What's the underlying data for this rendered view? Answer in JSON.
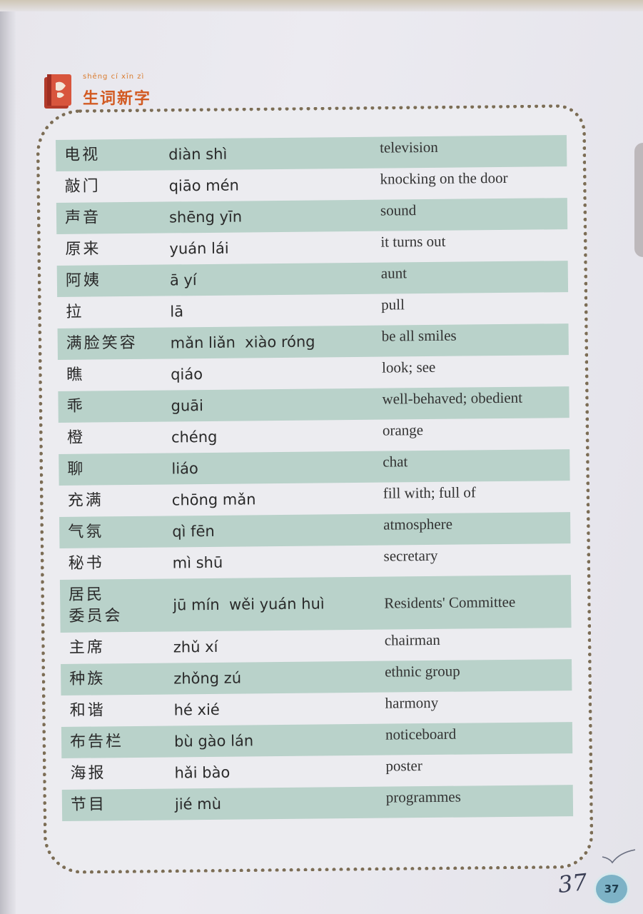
{
  "header": {
    "pinyin": "shēng cí  xīn zì",
    "title": "生词新字"
  },
  "vocab": [
    {
      "hanzi": "电视",
      "pinyin": "diàn shì",
      "english": "television"
    },
    {
      "hanzi": "敲门",
      "pinyin": "qiāo mén",
      "english": "knocking on the door"
    },
    {
      "hanzi": "声音",
      "pinyin": "shēng yīn",
      "english": "sound"
    },
    {
      "hanzi": "原来",
      "pinyin": "yuán lái",
      "english": "it turns out"
    },
    {
      "hanzi": "阿姨",
      "pinyin": "ā yí",
      "english": "aunt"
    },
    {
      "hanzi": "拉",
      "pinyin": "lā",
      "english": "pull"
    },
    {
      "hanzi": "满脸笑容",
      "pinyin": "mǎn liǎn  xiào róng",
      "english": "be all smiles"
    },
    {
      "hanzi": "瞧",
      "pinyin": "qiáo",
      "english": "look; see"
    },
    {
      "hanzi": "乖",
      "pinyin": "guāi",
      "english": "well-behaved; obedient"
    },
    {
      "hanzi": "橙",
      "pinyin": "chéng",
      "english": "orange"
    },
    {
      "hanzi": "聊",
      "pinyin": "liáo",
      "english": "chat"
    },
    {
      "hanzi": "充满",
      "pinyin": "chōng mǎn",
      "english": "fill with; full of"
    },
    {
      "hanzi": "气氛",
      "pinyin": "qì fēn",
      "english": "atmosphere"
    },
    {
      "hanzi": "秘书",
      "pinyin": "mì shū",
      "english": "secretary"
    },
    {
      "hanzi": "居民\n委员会",
      "pinyin": "jū mín  wěi yuán huì",
      "english": "Residents' Committee"
    },
    {
      "hanzi": "主席",
      "pinyin": "zhǔ xí",
      "english": "chairman"
    },
    {
      "hanzi": "种族",
      "pinyin": "zhǒng zú",
      "english": "ethnic group"
    },
    {
      "hanzi": "和谐",
      "pinyin": "hé xié",
      "english": "harmony"
    },
    {
      "hanzi": "布告栏",
      "pinyin": "bù gào lán",
      "english": "noticeboard"
    },
    {
      "hanzi": "海报",
      "pinyin": "hǎi bào",
      "english": "poster"
    },
    {
      "hanzi": "节目",
      "pinyin": "jié mù",
      "english": "programmes"
    }
  ],
  "footer": {
    "handwritten_number": "37",
    "page_number": "37"
  },
  "colors": {
    "row_shade": "#b9d2ca",
    "title_orange": "#d25a22",
    "badge_blue": "#7db2c6"
  }
}
